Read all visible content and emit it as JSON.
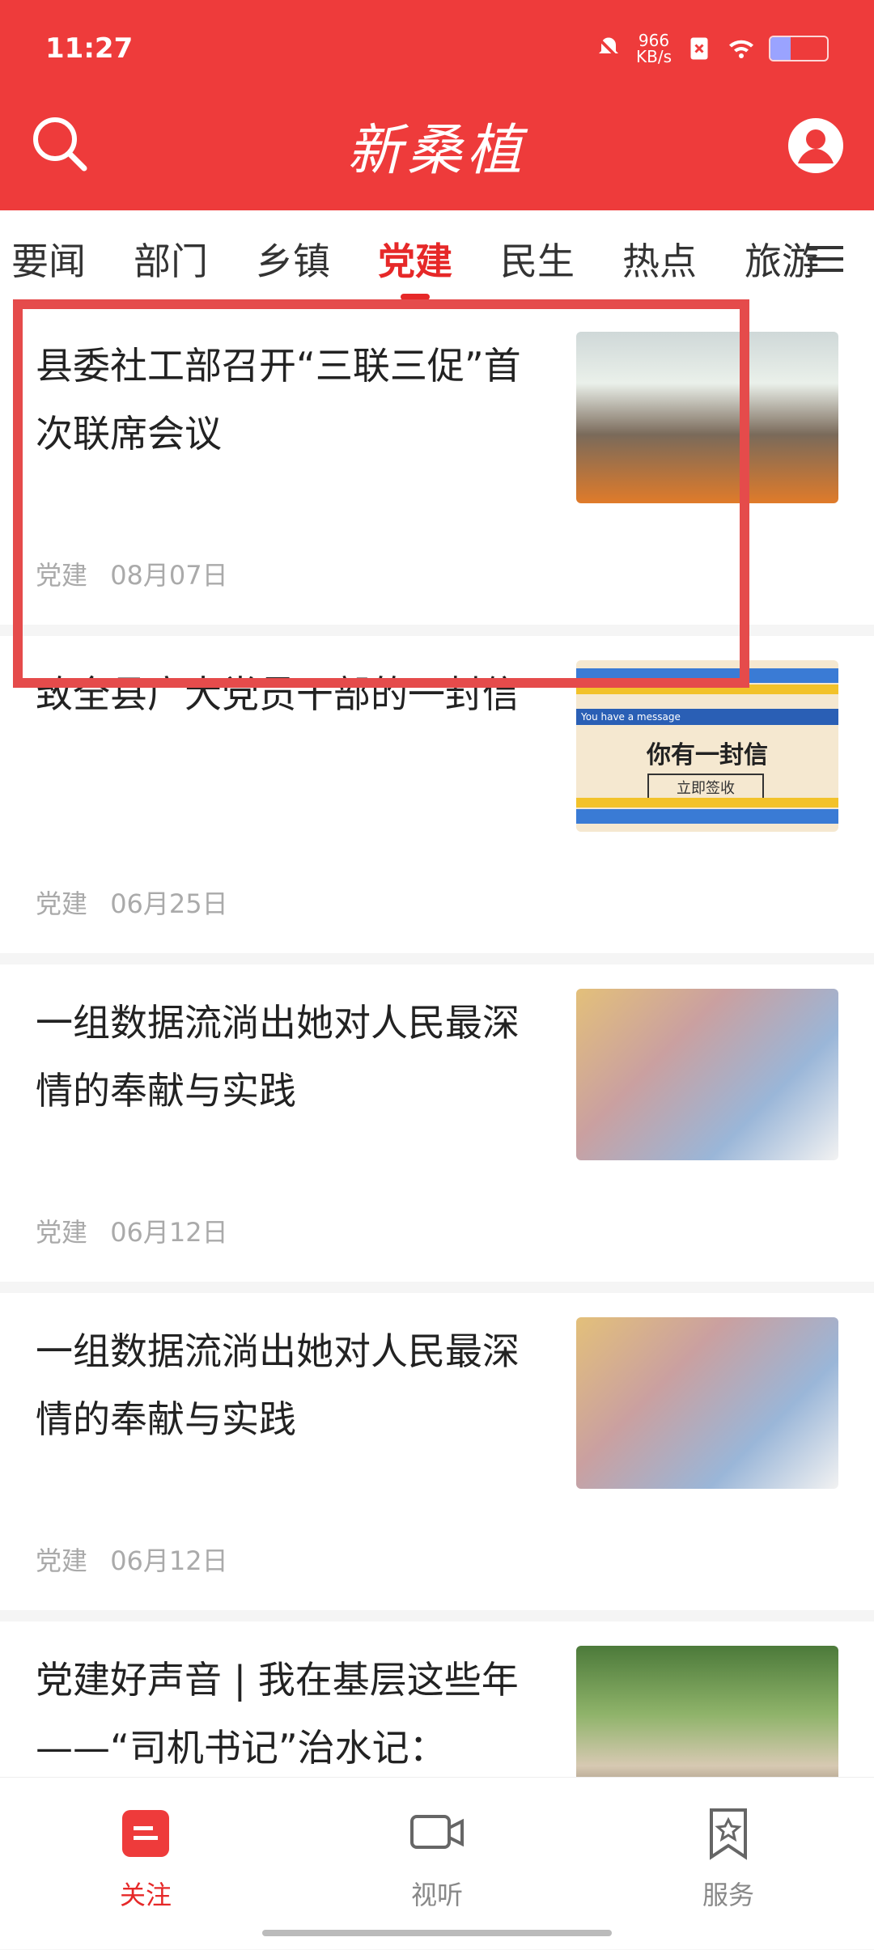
{
  "status": {
    "time": "11:27",
    "net_speed_value": "966",
    "net_speed_unit": "KB/s",
    "battery_fill_fraction": 0.35
  },
  "header": {
    "logo_text": "新桑植",
    "search_icon": "search-icon",
    "profile_icon": "profile-icon"
  },
  "tabs": [
    {
      "label": "要闻",
      "active": false
    },
    {
      "label": "部门",
      "active": false
    },
    {
      "label": "乡镇",
      "active": false
    },
    {
      "label": "党建",
      "active": true
    },
    {
      "label": "民生",
      "active": false
    },
    {
      "label": "热点",
      "active": false
    },
    {
      "label": "旅游",
      "active": false
    }
  ],
  "feed": [
    {
      "title": "县委社工部召开“三联三促”首次联席会议",
      "category": "党建",
      "date": "08月07日",
      "thumb": "meeting-photo"
    },
    {
      "title": "致全县广大党员干部的一封信",
      "category": "党建",
      "date": "06月25日",
      "thumb": "letter-graphic",
      "thumb_text": {
        "bar": "You have a message",
        "big": "你有一封信",
        "button": "立即签收"
      }
    },
    {
      "title": "一组数据流淌出她对人民最深情的奉献与实践",
      "category": "党建",
      "date": "06月12日",
      "thumb": "woman-writing-photo"
    },
    {
      "title": "一组数据流淌出她对人民最深情的奉献与实践",
      "category": "党建",
      "date": "06月12日",
      "thumb": "woman-writing-photo"
    },
    {
      "title": "党建好声音 | 我在基层这些年——“司机书记”治水记：",
      "category": "",
      "date": "",
      "thumb": "crowd-photo"
    }
  ],
  "bottom_nav": [
    {
      "label": "关注",
      "icon": "follow-icon",
      "active": true
    },
    {
      "label": "视听",
      "icon": "video-icon",
      "active": false
    },
    {
      "label": "服务",
      "icon": "bookmark-star-icon",
      "active": false
    }
  ],
  "colors": {
    "brand_red": "#ee3b3b",
    "active_red": "#e62828"
  }
}
